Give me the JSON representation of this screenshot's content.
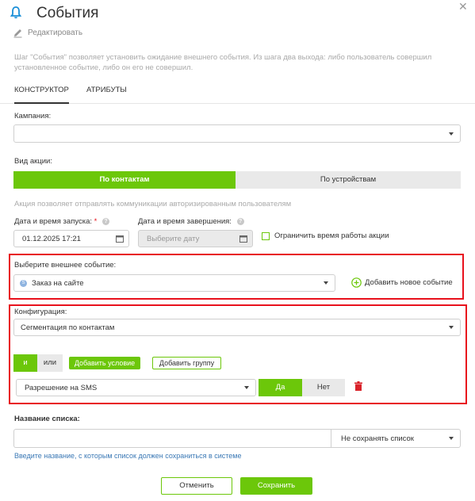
{
  "header": {
    "title": "События",
    "edit_label": "Редактировать",
    "description": "Шаг \"События\" позволяет установить ожидание внешнего события. Из шага два выхода: либо пользователь совершил установленное событие, либо он его не совершил."
  },
  "tabs": [
    {
      "label": "КОНСТРУКТОР",
      "active": true
    },
    {
      "label": "АТРИБУТЫ",
      "active": false
    }
  ],
  "campaign": {
    "label": "Кампания:",
    "value": ""
  },
  "action_type": {
    "label": "Вид акции:",
    "options": [
      "По контактам",
      "По устройствам"
    ],
    "selected": "По контактам",
    "hint": "Акция позволяет отправлять коммуникации авторизированным пользователям"
  },
  "start": {
    "label": "Дата и время запуска:",
    "required_mark": "*",
    "value": "01.12.2025 17:21"
  },
  "end": {
    "label": "Дата и время завершения:",
    "placeholder": "Выберите дату"
  },
  "limit_checkbox": {
    "label": "Ограничить время работы акции",
    "checked": false
  },
  "event": {
    "label": "Выберите внешнее событие:",
    "value": "Заказ на сайте",
    "add_label": "Добавить новое событие"
  },
  "config": {
    "label": "Конфигурация:",
    "value": "Сегментация по контактам",
    "logic_options": [
      "и",
      "или"
    ],
    "logic_selected": "и",
    "add_condition_label": "Добавить условие",
    "add_group_label": "Добавить группу",
    "condition": {
      "field": "Разрешение на SMS",
      "options": [
        "Да",
        "Нет"
      ],
      "selected": "Да"
    }
  },
  "list_name": {
    "label": "Название списка:",
    "value": "",
    "save_mode": "Не сохранять список",
    "hint": "Введите название, с которым список должен сохраниться в системе"
  },
  "footer": {
    "cancel_label": "Отменить",
    "save_label": "Сохранить"
  },
  "colors": {
    "accent": "#6cc70a",
    "highlight": "#e8111c",
    "delete": "#d9222a",
    "link": "#3a78b5"
  }
}
